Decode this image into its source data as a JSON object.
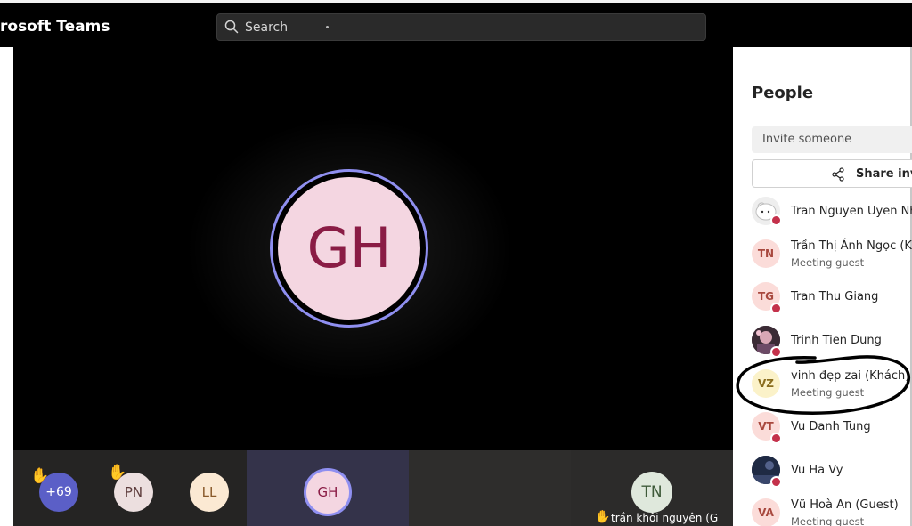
{
  "app": {
    "title": "rosoft Teams"
  },
  "search": {
    "placeholder": "Search"
  },
  "stage": {
    "main_avatar": {
      "initials": "GH",
      "bg": "#f4d6e1",
      "fg": "#8a1c45",
      "ring": "#8f8ff0"
    }
  },
  "gallery": {
    "overflow": {
      "label": "+69",
      "hand_raised": true,
      "bg": "#5b5fc7"
    },
    "tiles": [
      {
        "initials": "PN",
        "hand_raised": true,
        "bg": "#ecdfdf",
        "fg": "#5c3b3b"
      },
      {
        "initials": "LL",
        "hand_raised": false,
        "bg": "#fbe9d3",
        "fg": "#8a5a2b"
      },
      {
        "initials": "GH",
        "hand_raised": false,
        "bg": "#f4d6e1",
        "fg": "#8a1c45",
        "active": true
      },
      {
        "initials": "TN",
        "hand_raised": true,
        "bg": "#dfe8dc",
        "fg": "#3f5a3a",
        "name": "trần khôi nguyên (G"
      }
    ]
  },
  "people_panel": {
    "title": "People",
    "invite_placeholder": "Invite someone",
    "share_label": "Share inv",
    "participants": [
      {
        "name": "Tran Nguyen Uyen Nh",
        "subtitle": "",
        "avatar": "photo",
        "status": "busy"
      },
      {
        "name": "Trần Thị Ánh Ngọc (K",
        "subtitle": "Meeting guest",
        "initials": "TN",
        "bg": "#fbdcd9",
        "fg": "#a8483e",
        "status": ""
      },
      {
        "name": "Tran Thu Giang",
        "subtitle": "",
        "initials": "TG",
        "bg": "#fbdcd9",
        "fg": "#a8483e",
        "status": "busy"
      },
      {
        "name": "Trinh Tien Dung",
        "subtitle": "",
        "avatar": "photo",
        "status": "busy"
      },
      {
        "name": "vinh đẹp zai (Khách)",
        "subtitle": "Meeting guest",
        "initials": "VZ",
        "bg": "#fbf2c9",
        "fg": "#8a6d1e",
        "status": "",
        "circled": true
      },
      {
        "name": "Vu Danh Tung",
        "subtitle": "",
        "initials": "VT",
        "bg": "#fbdcd9",
        "fg": "#a8483e",
        "status": "busy"
      },
      {
        "name": "Vu Ha Vy",
        "subtitle": "",
        "avatar": "photo",
        "status": "busy"
      },
      {
        "name": "Vũ Hoà An (Guest)",
        "subtitle": "Meeting guest",
        "initials": "VA",
        "bg": "#fbdcd9",
        "fg": "#a8483e",
        "status": ""
      }
    ]
  },
  "colors": {
    "busy": "#c4314b",
    "accent": "#8f8ff0",
    "annotation": "#000000"
  }
}
